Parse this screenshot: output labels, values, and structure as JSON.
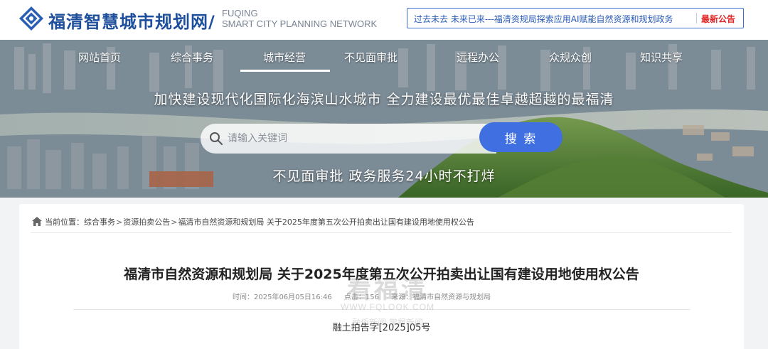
{
  "header": {
    "title": "福清智慧城市规划网/",
    "subtitle_en_line1": "FUQING",
    "subtitle_en_line2": "SMART CITY PLANNING NETWORK",
    "ticker_text": "过去未去 未来已来---福清资规局探索应用AI赋能自然资源和规划政务",
    "ticker_badge": "最新公告",
    "brand_color": "#1e4f9c",
    "badge_color": "#e02424"
  },
  "nav": {
    "items": [
      {
        "label": "网站首页"
      },
      {
        "label": "综合事务"
      },
      {
        "label": "城市经营"
      },
      {
        "label": "不见面审批"
      },
      {
        "label": "远程办公"
      },
      {
        "label": "众规众创"
      },
      {
        "label": "知识共享"
      }
    ],
    "active": "城市经营"
  },
  "banner": {
    "slogan_top": "加快建设现代化国际化海滨山水城市  全力建设最优最佳卓越超越的最福清",
    "slogan_bottom": "不见面审批   政务服务24小时不打烊"
  },
  "search": {
    "placeholder": "请输入关键词",
    "button_label": "搜 索",
    "button_color": "#3f6fe0"
  },
  "breadcrumb": {
    "prefix": "当前位置：",
    "items": [
      "综合事务",
      "资源拍卖公告",
      "福清市自然资源和规划局 关于2025年度第五次公开拍卖出让国有建设用地使用权公告"
    ],
    "separator": ">"
  },
  "article": {
    "title": "福清市自然资源和规划局 关于2025年度第五次公开拍卖出让国有建设用地使用权公告",
    "time": "时间：2025年06月05日16:46",
    "views": "点击：156",
    "source": "来源：福清市自然资源与规划局",
    "doc_number": "融土拍告字[2025]05号"
  },
  "watermark": {
    "main": "看福清",
    "url": "WWW.FQLOOK.COM",
    "sub": "融侨新闻 掌握新闻"
  }
}
